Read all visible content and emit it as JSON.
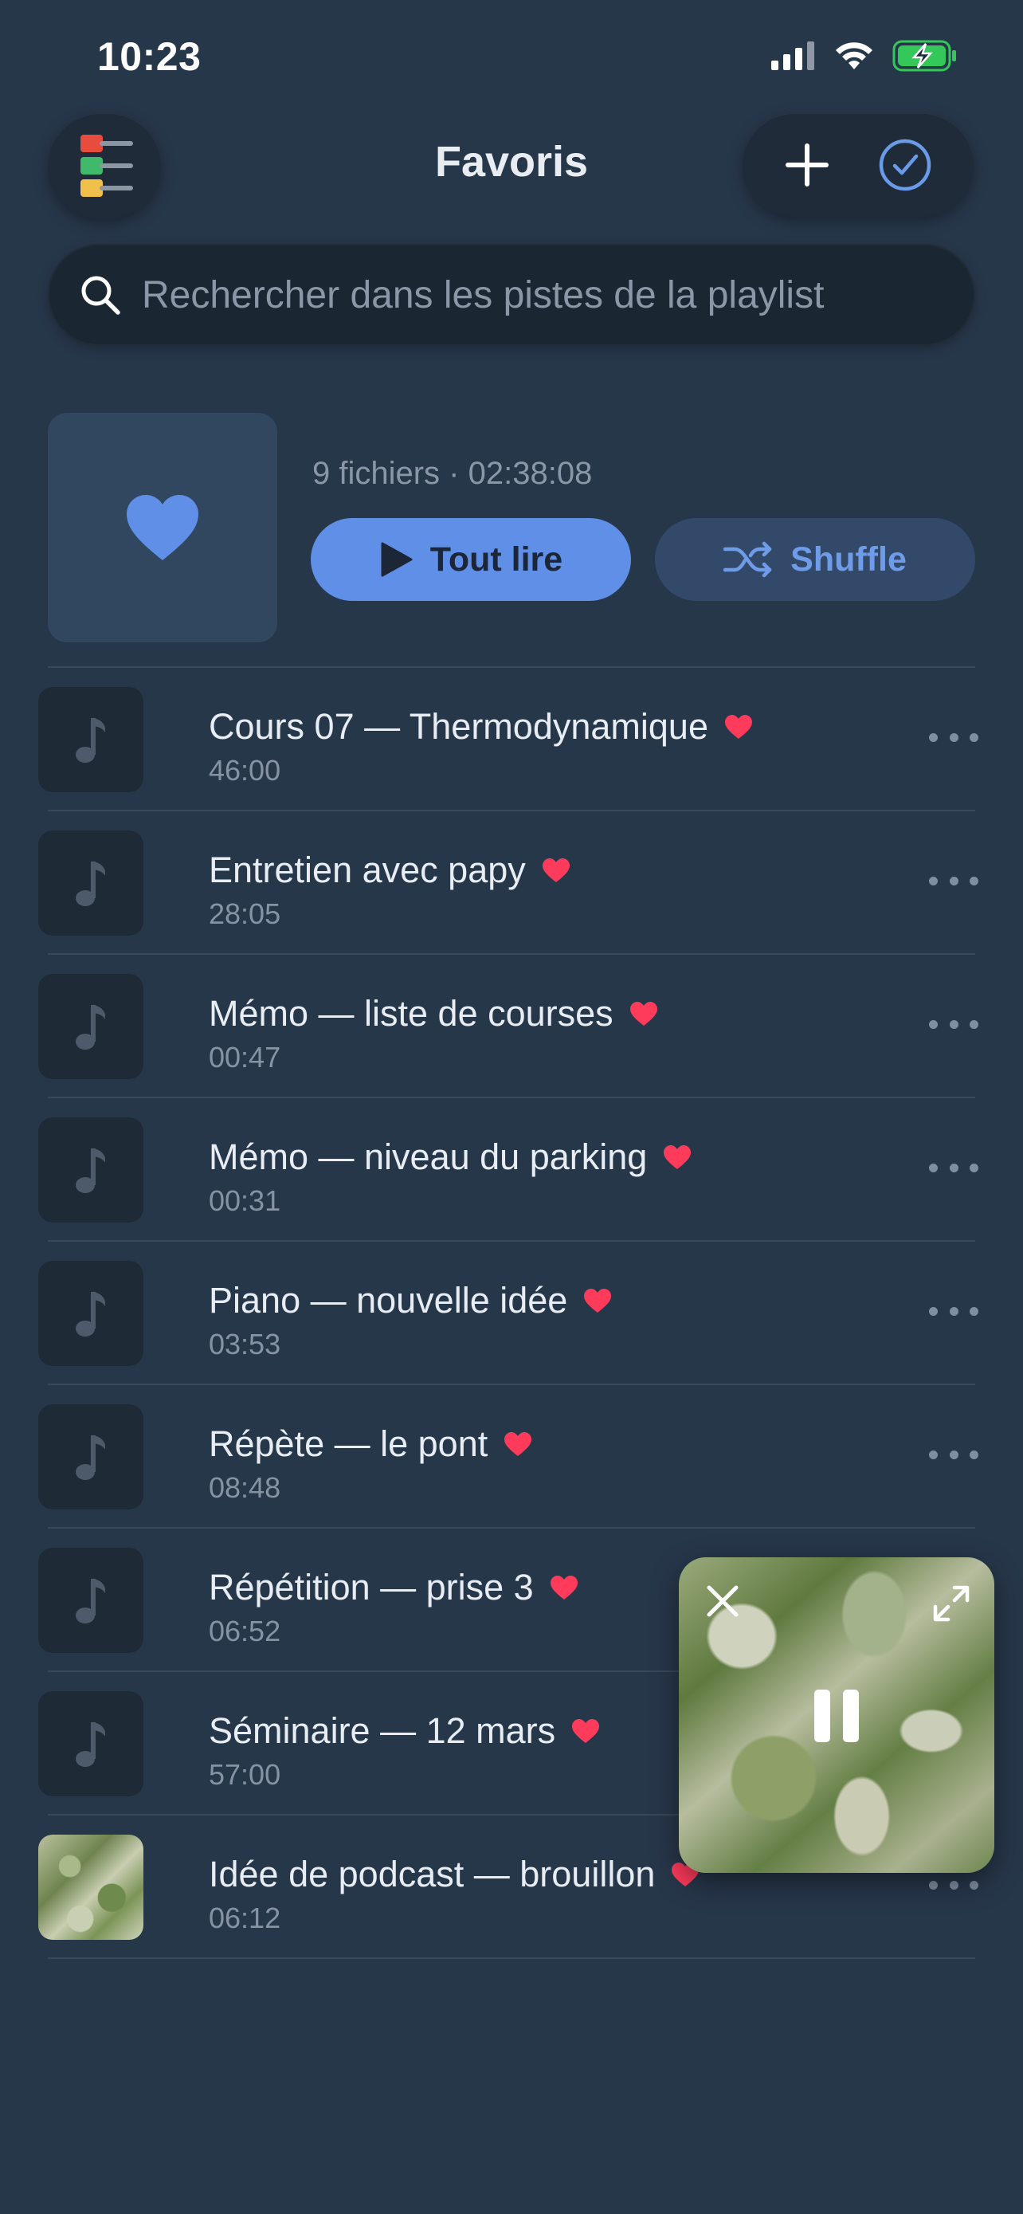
{
  "status": {
    "time": "10:23"
  },
  "header": {
    "title": "Favoris",
    "menu_icon": "menu-list-icon",
    "add_icon": "plus-icon",
    "select_icon": "check-circle-icon"
  },
  "search": {
    "placeholder": "Rechercher dans les pistes de la playlist"
  },
  "playlist": {
    "meta": "9 fichiers · 02:38:08",
    "play_all_label": "Tout lire",
    "shuffle_label": "Shuffle"
  },
  "tracks": [
    {
      "title": "Cours 07 — Thermodynamique",
      "duration": "46:00"
    },
    {
      "title": "Entretien avec papy",
      "duration": "28:05"
    },
    {
      "title": "Mémo — liste de courses",
      "duration": "00:47"
    },
    {
      "title": "Mémo — niveau du parking",
      "duration": "00:31"
    },
    {
      "title": "Piano — nouvelle idée",
      "duration": "03:53"
    },
    {
      "title": "Répète — le pont",
      "duration": "08:48"
    },
    {
      "title": "Répétition — prise 3",
      "duration": "06:52"
    },
    {
      "title": "Séminaire — 12 mars",
      "duration": "57:00"
    },
    {
      "title": "Idée de podcast — brouillon",
      "duration": "06:12"
    }
  ],
  "colors": {
    "background": "#27374a",
    "accent": "#5f8fe6",
    "heart": "#ff3b5c",
    "battery": "#34c759"
  }
}
